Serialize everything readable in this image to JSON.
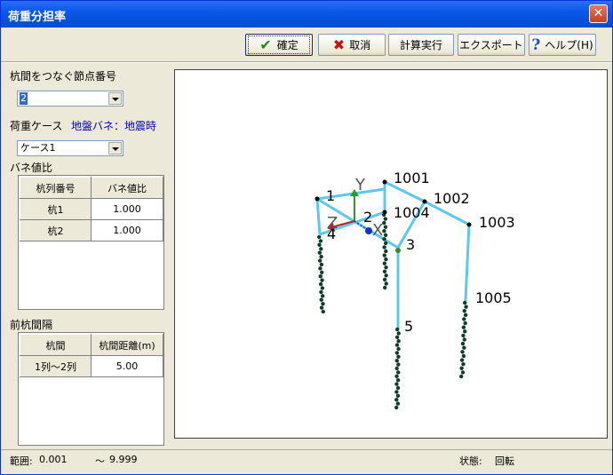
{
  "window": {
    "title": "荷重分担率",
    "close_glyph": "✕"
  },
  "toolbar": {
    "confirm_label": "確定",
    "cancel_label": "取消",
    "calc_label": "計算実行",
    "export_label": "エクスポート",
    "help_label": "ヘルプ(H)"
  },
  "left": {
    "node_label": "杭間をつなぐ節点番号",
    "node_value": "2",
    "loadcase_label": "荷重ケース",
    "loadcase_info": "地盤バネ：地震時",
    "loadcase_value": "ケース1",
    "spring_label": "バネ値比",
    "spring_table": {
      "headers": [
        "杭列番号",
        "バネ値比"
      ],
      "rows": [
        [
          "杭1",
          "1.000"
        ],
        [
          "杭2",
          "1.000"
        ]
      ]
    },
    "spacing_label": "前杭間隔",
    "spacing_table": {
      "headers": [
        "杭間",
        "杭間距離(m)"
      ],
      "rows": [
        [
          "1列～2列",
          "5.00"
        ]
      ]
    }
  },
  "viewport": {
    "axis_labels": {
      "x": "X",
      "y": "Y",
      "z": "Z"
    },
    "nodes": [
      "1",
      "2",
      "3",
      "4",
      "5",
      "1001",
      "1002",
      "1003",
      "1004",
      "1005"
    ]
  },
  "status": {
    "range_label": "範囲:",
    "range_min": "0.001",
    "range_sep": "～",
    "range_max": "9.999",
    "state_label": "状態:",
    "state_value": "回転"
  }
}
